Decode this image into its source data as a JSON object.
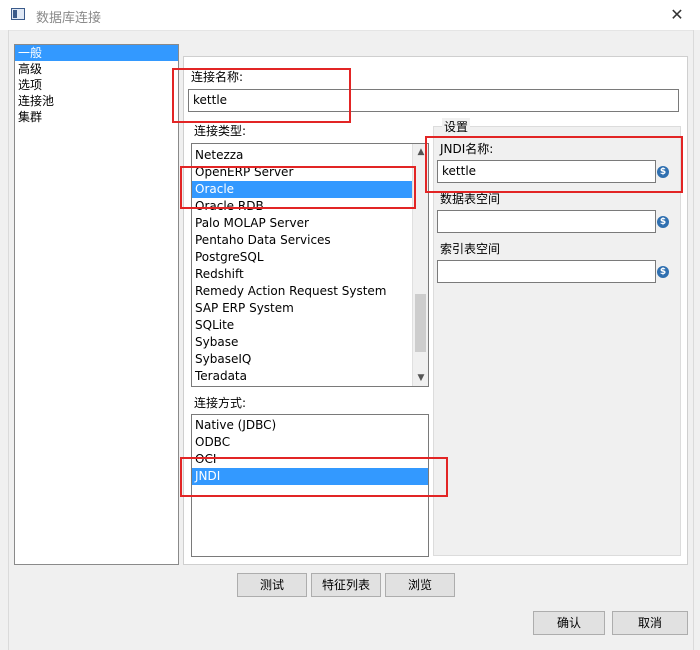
{
  "window": {
    "title": "数据库连接",
    "close_glyph": "✕"
  },
  "nav": {
    "items": [
      "一般",
      "高级",
      "选项",
      "连接池",
      "集群"
    ],
    "selected_index": 0
  },
  "general": {
    "connection_name_label": "连接名称:",
    "connection_name_value": "kettle",
    "connection_type_label": "连接类型:",
    "connection_types": [
      "Netezza",
      "OpenERP Server",
      "Oracle",
      "Oracle RDB",
      "Palo MOLAP Server",
      "Pentaho Data Services",
      "PostgreSQL",
      "Redshift",
      "Remedy Action Request System",
      "SAP ERP System",
      "SQLite",
      "Sybase",
      "SybaseIQ",
      "Teradata"
    ],
    "selected_connection_type": "Oracle",
    "access_label": "连接方式:",
    "access_methods": [
      "Native (JDBC)",
      "ODBC",
      "OCI",
      "JNDI"
    ],
    "selected_access_method": "JNDI"
  },
  "settings": {
    "group_title": "设置",
    "jndi_name_label": "JNDI名称:",
    "jndi_name_value": "kettle",
    "data_tablespace_label": "数据表空间",
    "data_tablespace_value": "",
    "index_tablespace_label": "索引表空间",
    "index_tablespace_value": "",
    "variable_icon": "$"
  },
  "buttons": {
    "test": "测试",
    "feature_list": "特征列表",
    "explore": "浏览",
    "ok": "确认",
    "cancel": "取消"
  },
  "scroll": {
    "up": "▲",
    "down": "▼"
  },
  "colors": {
    "selection": "#3399ff",
    "annotation": "#e22525"
  }
}
